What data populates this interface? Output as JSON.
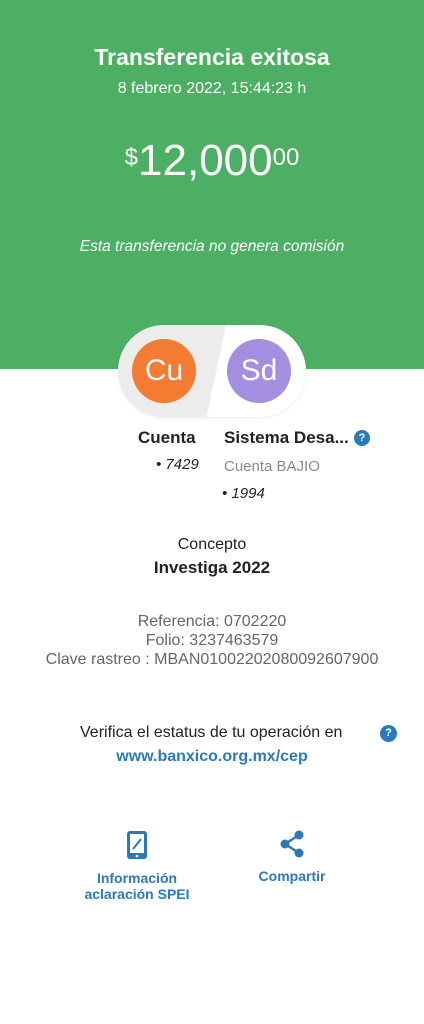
{
  "header": {
    "title": "Transferencia exitosa",
    "datetime": "8 febrero 2022, 15:44:23 h",
    "amount": {
      "currency": "$",
      "main": "12,000",
      "cents": "00"
    },
    "fee_note": "Esta transferencia no genera comisión"
  },
  "sender": {
    "initials": "Cu",
    "name": "Cuenta",
    "account": "• 7429"
  },
  "receiver": {
    "initials": "Sd",
    "name": "Sistema Desa...",
    "bank": "Cuenta BAJIO",
    "account": "• 1994"
  },
  "concept": {
    "label": "Concepto",
    "value": "Investiga 2022"
  },
  "references": {
    "referencia": "Referencia: 0702220",
    "folio": "Folio: 3237463579",
    "clave": "Clave rastreo : MBAN01002202080092607900"
  },
  "verify": {
    "text": "Verifica el estatus de tu operación en",
    "link": "www.banxico.org.mx/cep"
  },
  "actions": {
    "info_line1": "Información",
    "info_line2": "aclaración SPEI",
    "share": "Compartir"
  },
  "icons": {
    "help": "?",
    "phone": "phone-icon",
    "share": "share-icon"
  },
  "colors": {
    "green": "#4caf63",
    "accent_blue": "#2a7ab9",
    "orange": "#f47b32",
    "purple": "#a38ee0"
  }
}
